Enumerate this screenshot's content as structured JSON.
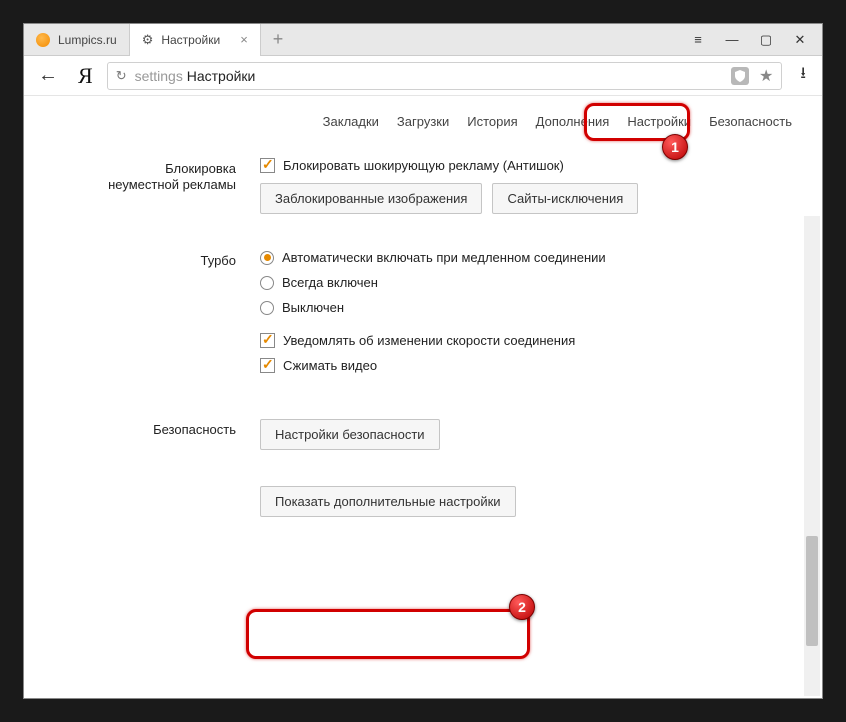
{
  "tabs": [
    {
      "title": "Lumpics.ru"
    },
    {
      "title": "Настройки"
    }
  ],
  "address": {
    "prefix": "settings",
    "path": "Настройки"
  },
  "nav": {
    "bookmarks": "Закладки",
    "downloads": "Загрузки",
    "history": "История",
    "addons": "Дополнения",
    "settings": "Настройки",
    "security": "Безопасность"
  },
  "sections": {
    "adblock": {
      "label_line1": "Блокировка",
      "label_line2": "неуместной рекламы",
      "block_shocking": "Блокировать шокирующую рекламу (Антишок)",
      "blocked_images_btn": "Заблокированные изображения",
      "exceptions_btn": "Сайты-исключения"
    },
    "turbo": {
      "label": "Турбо",
      "opt_auto": "Автоматически включать при медленном соединении",
      "opt_always": "Всегда включен",
      "opt_off": "Выключен",
      "notify_speed": "Уведомлять об изменении скорости соединения",
      "compress_video": "Сжимать видео"
    },
    "safety": {
      "label": "Безопасность",
      "btn": "Настройки безопасности"
    },
    "advanced": {
      "btn": "Показать дополнительные настройки"
    }
  },
  "markers": {
    "one": "1",
    "two": "2"
  }
}
